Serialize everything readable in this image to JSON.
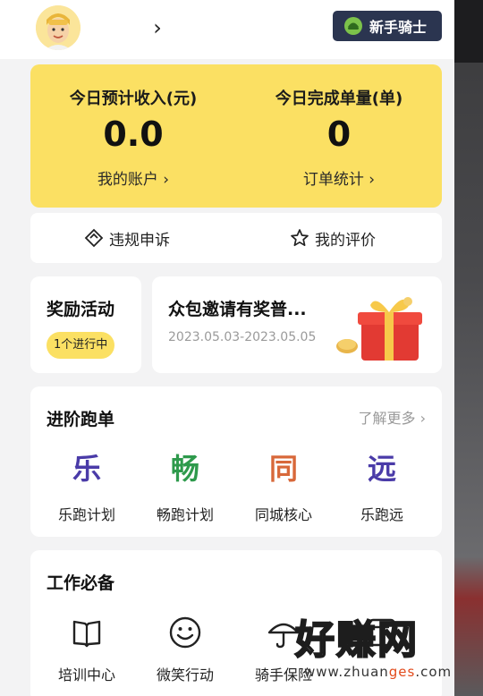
{
  "header": {
    "chevron": "›",
    "rider_badge": "新手骑士"
  },
  "stats": {
    "income_title": "今日预计收入(元)",
    "income_value": "0.0",
    "income_link": "我的账户 ›",
    "orders_title": "今日完成单量(单)",
    "orders_value": "0",
    "orders_link": "订单统计 ›"
  },
  "actions": {
    "appeal_label": "违规申诉",
    "rating_label": "我的评价"
  },
  "rewards": {
    "title": "奖励活动",
    "status_pill": "1个进行中",
    "promo_title": "众包邀请有奖普...",
    "promo_dates": "2023.05.03-2023.05.05"
  },
  "advanced": {
    "title": "进阶跑单",
    "learn_more": "了解更多 ›",
    "plans": [
      {
        "glyph": "乐",
        "label": "乐跑计划",
        "color": "#4a3ba8"
      },
      {
        "glyph": "畅",
        "label": "畅跑计划",
        "color": "#2e9a4c"
      },
      {
        "glyph": "同",
        "label": "同城核心",
        "color": "#d8683a"
      },
      {
        "glyph": "远",
        "label": "乐跑远",
        "color": "#4a3ba8"
      }
    ]
  },
  "work": {
    "title": "工作必备",
    "tools": [
      {
        "label": "培训中心",
        "icon": "book-icon"
      },
      {
        "label": "微笑行动",
        "icon": "smile-icon"
      },
      {
        "label": "骑手保险",
        "icon": "umbrella-icon"
      },
      {
        "label": "",
        "icon": "card-icon"
      }
    ]
  },
  "watermark": {
    "text": "好赚网",
    "url_prefix": "www.zhuan",
    "url_highlight": "ges",
    "url_suffix": ".com"
  },
  "colors": {
    "accent_yellow": "#fbe063",
    "badge_navy": "#2b3550"
  }
}
